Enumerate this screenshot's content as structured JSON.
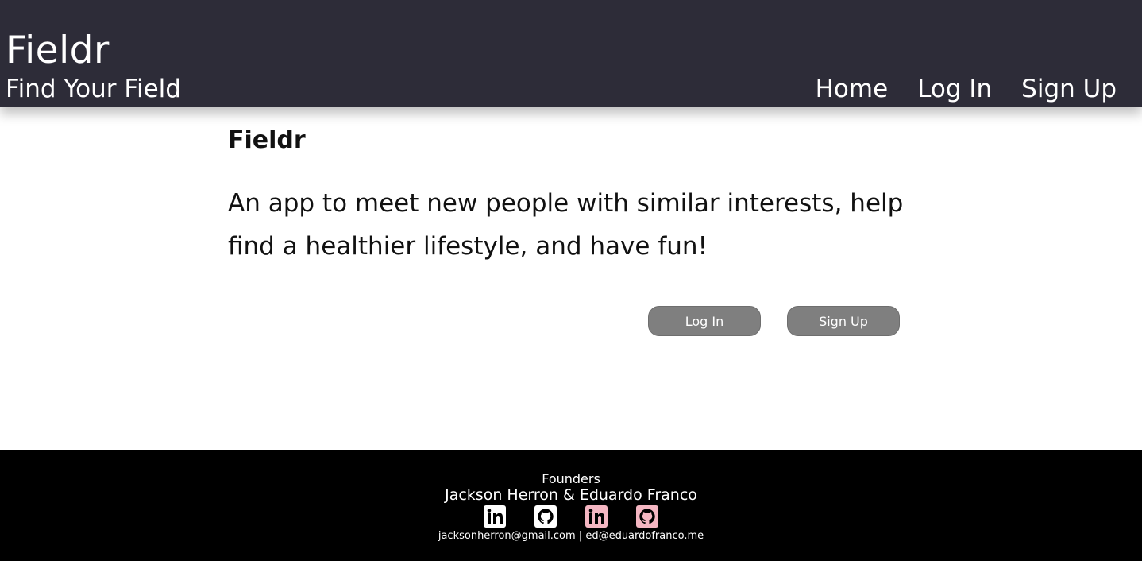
{
  "header": {
    "title": "Fieldr",
    "tagline": "Find Your Field",
    "nav": [
      {
        "label": "Home"
      },
      {
        "label": "Log In"
      },
      {
        "label": "Sign Up"
      }
    ]
  },
  "main": {
    "title": "Fieldr",
    "description": "An app to meet new people with similar interests, help find a healthier lifestyle, and have fun!",
    "login_button": "Log In",
    "signup_button": "Sign Up"
  },
  "footer": {
    "label": "Founders",
    "names": "Jackson Herron & Eduardo Franco",
    "icons": [
      "linkedin-icon",
      "github-icon",
      "linkedin-icon",
      "github-icon"
    ],
    "emails": "jacksonherron@gmail.com | ed@eduardofranco.me",
    "colors": {
      "white_icon": "#ffffff",
      "pink_icon": "#f4b6c2"
    }
  },
  "colors": {
    "header_bg": "#2d2c38",
    "footer_bg": "#000000",
    "button_bg": "#7f7f7f"
  }
}
